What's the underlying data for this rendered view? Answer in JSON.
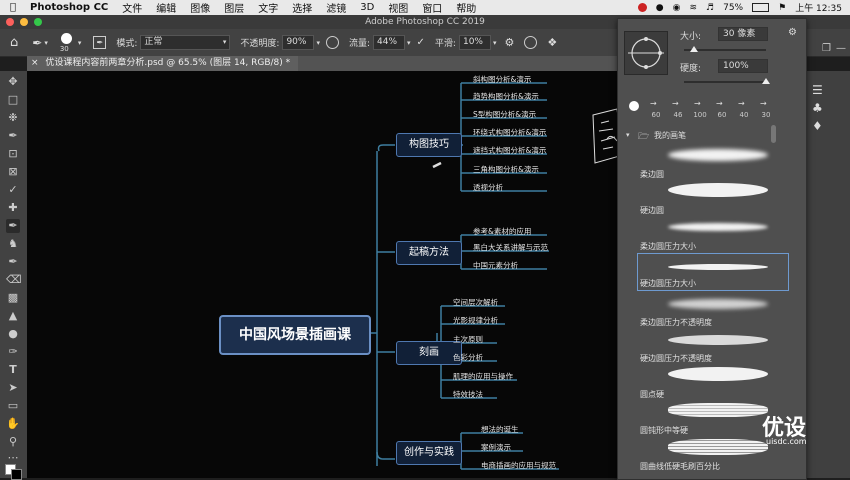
{
  "menubar": {
    "app": "Photoshop CC",
    "items": [
      "文件",
      "编辑",
      "图像",
      "图层",
      "文字",
      "选择",
      "滤镜",
      "3D",
      "视图",
      "窗口",
      "帮助"
    ],
    "battery": "75%",
    "clock": "上午 12:35"
  },
  "window": {
    "title": "Adobe Photoshop CC 2019"
  },
  "options": {
    "brush_size": "30",
    "mode_label": "模式:",
    "mode_value": "正常",
    "opacity_label": "不透明度:",
    "opacity_value": "90%",
    "flow_label": "流量:",
    "flow_value": "44%",
    "smooth_label": "平滑:",
    "smooth_value": "10%"
  },
  "document": {
    "tab_title": "优设课程内容前两章分析.psd @ 65.5% (图层 14, RGB/8) *"
  },
  "mindmap": {
    "root": "中国风场景插画课",
    "branches": [
      {
        "label": "构图技巧",
        "leaves": [
          "斜构图分析&演示",
          "趋势构图分析&演示",
          "S型构图分析&演示",
          "环绕式构图分析&演示",
          "遮挡式构图分析&演示",
          "三角构图分析&演示",
          "透视分析"
        ]
      },
      {
        "label": "起稿方法",
        "leaves": [
          "参考&素材的应用",
          "黑白大关系讲解与示范",
          "中国元素分析"
        ]
      },
      {
        "label": "刻画",
        "leaves": [
          "空间层次解析",
          "光影规律分析",
          "主次原则",
          "色彩分析",
          "肌理的应用与操作",
          "特效技法"
        ]
      },
      {
        "label": "创作与实践",
        "leaves": [
          "想法的诞生",
          "案例演示",
          "电商插画的应用与规范"
        ]
      }
    ]
  },
  "brush_panel": {
    "size_label": "大小:",
    "size_value": "30 像素",
    "hardness_label": "硬度:",
    "hardness_value": "100%",
    "tip_sizes": [
      "60",
      "46",
      "100",
      "60",
      "40",
      "30"
    ],
    "group_name": "我的画笔",
    "brushes": [
      "柔边圆",
      "硬边圆",
      "柔边圆压力大小",
      "硬边圆压力大小",
      "柔边圆压力不透明度",
      "硬边圆压力不透明度",
      "圆点硬",
      "圆钝形中等硬",
      "圆曲线低硬毛刷百分比"
    ]
  },
  "watermark": {
    "logo": "优设",
    "url": "uisdc.com"
  },
  "colors": {
    "node_border": "#6b90c5",
    "node_fill": "#1c2f4d",
    "connector": "#3f7fa0",
    "canvas_bg": "#070707"
  }
}
